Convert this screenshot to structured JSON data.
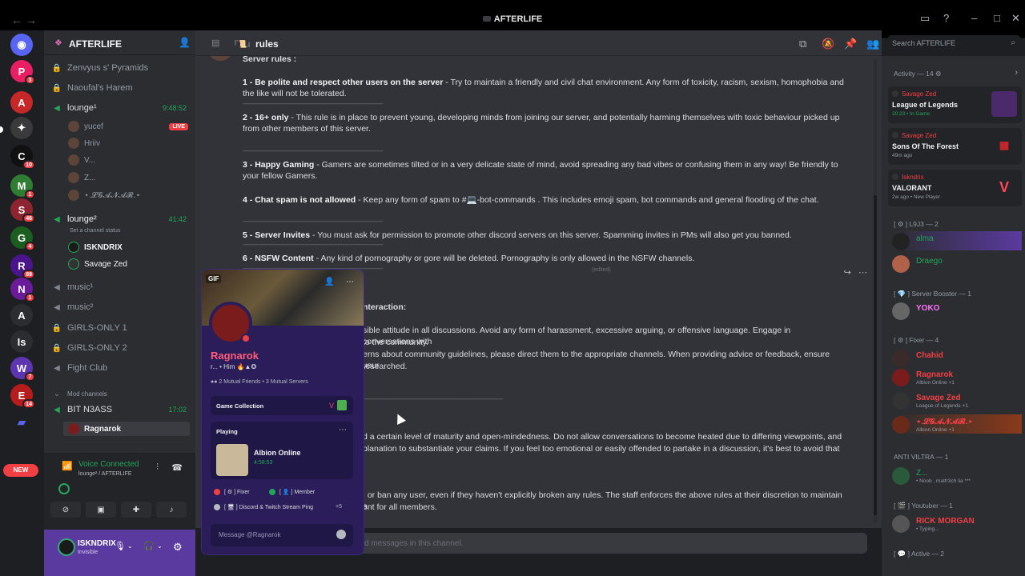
{
  "window": {
    "title": "AFTERLIFE"
  },
  "server": {
    "name": "AFTERLIFE",
    "new_label": "NEW"
  },
  "channels": [
    {
      "name": "Zenvyus s' Pyramids",
      "type": "locked"
    },
    {
      "name": "Naoufal's Harem",
      "type": "locked"
    },
    {
      "name": "lounge¹",
      "type": "voice",
      "time": "9:48:52"
    },
    {
      "name": "lounge²",
      "type": "voice",
      "time": "41:42"
    },
    {
      "name": "music¹",
      "type": "voice-muted"
    },
    {
      "name": "music²",
      "type": "voice-muted"
    },
    {
      "name": "GIRLS-ONLY 1",
      "type": "locked"
    },
    {
      "name": "GIRLS-ONLY 2",
      "type": "locked"
    },
    {
      "name": "Fight Club",
      "type": "voice-muted"
    },
    {
      "name": "Mod channels",
      "type": "category"
    },
    {
      "name": "BIT N3ASS",
      "type": "voice",
      "time": "17:02"
    }
  ],
  "voice_users_1": [
    "yucef",
    "Hriiv",
    "V...",
    "Z...",
    "⋆.𝓛𝓖𝓐𝓝𝓐𝓡.⋆"
  ],
  "live_label": "LIVE",
  "status_hint": "Set a channel status",
  "voice_users_2": [
    "ISKNDRIX",
    "Savage Zed"
  ],
  "voice_users_3": [
    "Ragnarok"
  ],
  "voice": {
    "status": "Voice Connected",
    "channel": "lounge² / AFTERLIFE"
  },
  "user": {
    "name": "ISKNDRIX",
    "status": "Invisible"
  },
  "chat": {
    "channel": "rules",
    "rules_title": "Server rules :",
    "rules": [
      {
        "n": "1",
        "title": "Be polite and respect other users on the server",
        "text": " - Try to maintain a friendly and civil chat environment. Any form of toxicity, racism, sexism, homophobia and the like will not be tolerated."
      },
      {
        "n": "2",
        "title": "16+ only",
        "text": " -  This rule is in place to prevent young, developing minds from joining our server, and potentially harming themselves with toxic behaviour picked up from other members of this server."
      },
      {
        "n": "3",
        "title": "Happy Gaming",
        "text": " - Gamers are sometimes tilted or in a very delicate state of mind, avoid spreading any bad vibes or confusing them in any way! Be friendly to your fellow Gamers."
      },
      {
        "n": "4",
        "title": "Chat spam is not allowed",
        "text": " - Keep any form of spam to #💻-bot-commands . This includes emoji spam, bot commands and general flooding of the chat."
      },
      {
        "n": "5",
        "title": "Server Invites",
        "text": " - You must ask for permission to promote other discord servers on this server. Spamming invites in PMs will also get you banned."
      },
      {
        "n": "6",
        "title": "NSFW Content",
        "text": " - Any kind of pornography or gore will be deleted. Pornography is only allowed in the NSFW channels."
      }
    ],
    "edited": "(edited)",
    "divider": "---------------------------------------------------------------------------------------------------------",
    "m2_title": "nteraction:",
    "m2_lines": [
      "sible attitude in all discussions. Avoid any form of harassment, excessive arguing, or offensive language. Engage in conversations with",
      " to the community.",
      "erns about community guidelines, please direct them to the appropriate channels. When providing advice or feedback, ensure your",
      "researched."
    ],
    "m3_lines": [
      "d a certain level of maturity and open-mindedness. Do not allow conversations to become heated due to differing viewpoints, and",
      "planation to substantiate your claims. If you feel too emotional or easily offended to partake in a discussion, it's best to avoid that"
    ],
    "m4_lines": [
      ", or ban any user, even if they haven't explicitly broken any rules. The staff enforces the above rules at their discretion to maintain a",
      "ent for all members."
    ],
    "input_placeholder": "d messages in this channel."
  },
  "search": {
    "placeholder": "Search AFTERLIFE"
  },
  "profile": {
    "gif": "GIF",
    "name": "Ragnarok",
    "pronouns": "r... • Him",
    "mutual": "2 Mutual Friends • 3 Mutual Servers",
    "collection": "Game Collection",
    "playing": "Playing",
    "game": "Albion Online",
    "game_time": "4:58:53",
    "roles": [
      {
        "name": "[ ⚙ ] Fixer",
        "color": "#f23f43"
      },
      {
        "name": "[ 👤 ] Member",
        "color": "#23a55a"
      },
      {
        "name": "[ 🖥 ] Discord & Twitch Stream Ping",
        "color": "#b5bac1"
      }
    ],
    "more_roles": "+5",
    "message_placeholder": "Message @Ragnarok"
  },
  "members": {
    "activity_header": "Activity — 14",
    "activities": [
      {
        "user": "Savage Zed",
        "game": "League of Legends",
        "detail": "20:23 • In Game",
        "color": "#7a3a9a"
      },
      {
        "user": "Savage Zed",
        "game": "Sons Of The Forest",
        "detail": "49m ago",
        "color": "#c0262a"
      },
      {
        "user": "Iskndrix",
        "game": "VALORANT",
        "detail": "2w ago • New Player",
        "color": "#ff4655"
      }
    ],
    "groups": [
      {
        "header": "[ ⚙ ] L9J3 — 2",
        "items": [
          {
            "name": "alma",
            "color": "#23a55a",
            "sub": ""
          },
          {
            "name": "Draego",
            "color": "#23a55a",
            "sub": ""
          }
        ]
      },
      {
        "header": "[ 💎 ] Server Booster — 1",
        "items": [
          {
            "name": "YOKO",
            "color": "#ff73fa",
            "sub": ""
          }
        ]
      },
      {
        "header": "[ ⚙ ] Fixer — 4",
        "items": [
          {
            "name": "Chahid",
            "color": "#f23f43",
            "sub": ""
          },
          {
            "name": "Ragnarok",
            "color": "#f23f43",
            "sub": "Albion Online +1"
          },
          {
            "name": "Savage Zed",
            "color": "#f23f43",
            "sub": "League of Legends +1"
          },
          {
            "name": "⋆.𝓛𝓖𝓐𝓝𝓐𝓡.⋆",
            "color": "#f23f43",
            "sub": "Albion Online +1"
          }
        ]
      },
      {
        "header": "ANTI VILTRA — 1",
        "items": [
          {
            "name": "Z...",
            "color": "#23a55a",
            "sub": "• Noob , matfr3ch lia ***"
          }
        ]
      },
      {
        "header": "[ 🎬 ] Youtuber — 1",
        "items": [
          {
            "name": "RICK MORGAN",
            "color": "#f23f43",
            "sub": "• Typing..."
          }
        ]
      },
      {
        "header": "[ 💬 ] Active — 2",
        "items": []
      }
    ]
  }
}
